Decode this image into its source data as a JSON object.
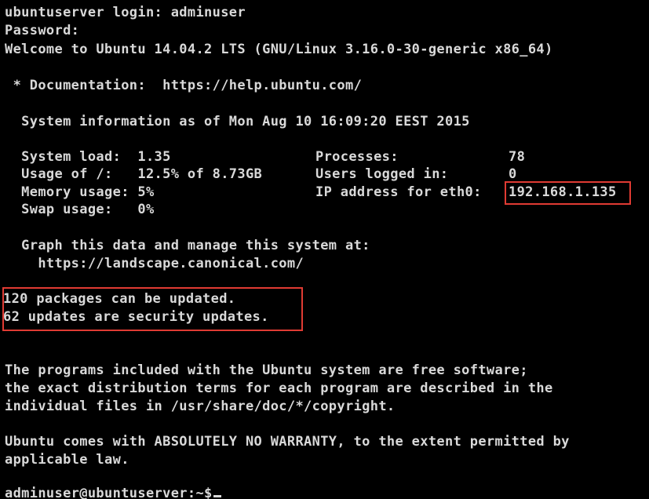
{
  "terminal": {
    "login": "ubuntuserver login: adminuser",
    "password": "Password:",
    "welcome": "Welcome to Ubuntu 14.04.2 LTS (GNU/Linux 3.16.0-30-generic x86_64)",
    "documentation": " * Documentation:  https://help.ubuntu.com/",
    "sysinfo_header": "  System information as of Mon Aug 10 16:09:20 EEST 2015",
    "stats": [
      {
        "label": "  System load:  1.35",
        "key": "Processes:",
        "value": "78"
      },
      {
        "label": "  Usage of /:   12.5% of 8.73GB",
        "key": "Users logged in:",
        "value": "0"
      },
      {
        "label": "  Memory usage: 5%",
        "key": "IP address for eth0:",
        "value": "192.168.1.135"
      },
      {
        "label": "  Swap usage:   0%",
        "key": "",
        "value": ""
      }
    ],
    "graph_line1": "  Graph this data and manage this system at:",
    "graph_line2": "    https://landscape.canonical.com/",
    "updates_line1": "120 packages can be updated.",
    "updates_line2": "62 updates are security updates.",
    "programs_line1": "The programs included with the Ubuntu system are free software;",
    "programs_line2": "the exact distribution terms for each program are described in the",
    "programs_line3": "individual files in /usr/share/doc/*/copyright.",
    "warranty_line1": "Ubuntu comes with ABSOLUTELY NO WARRANTY, to the extent permitted by",
    "warranty_line2": "applicable law.",
    "prompt": "adminuser@ubuntuserver:~$"
  },
  "colors": {
    "background": "#000000",
    "text": "#d9d9d9",
    "highlight": "#e03b33"
  }
}
